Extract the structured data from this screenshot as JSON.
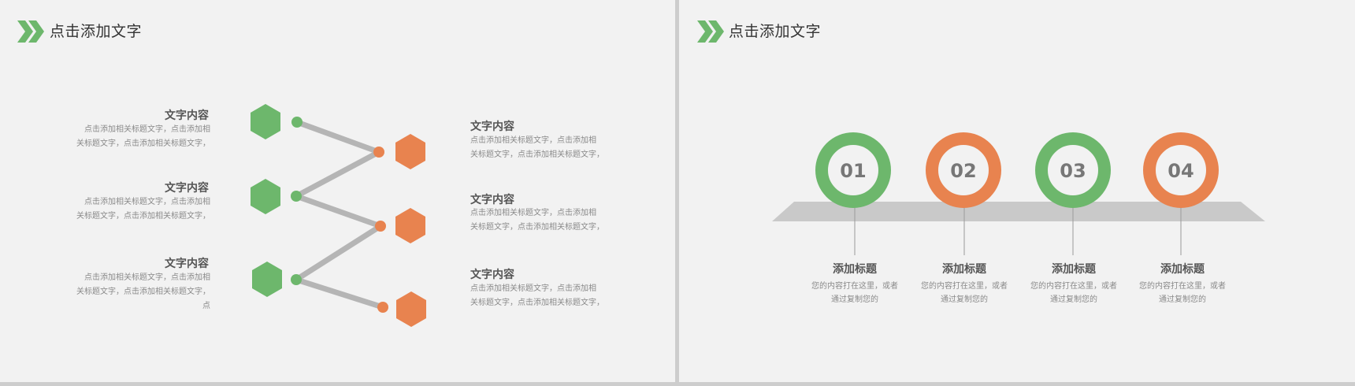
{
  "colors": {
    "green": "#6db76c",
    "orange": "#e8834f",
    "connector": "#b5b5b5",
    "platform": "#c9c9c9"
  },
  "left_slide": {
    "title": "点击添加文字",
    "title_icon": "double-chevron-right-icon",
    "left_items": [
      {
        "heading": "文字内容",
        "lines": [
          "点击添加相关标题文字，点击添加相",
          "关标题文字，点击添加相关标题文字，"
        ]
      },
      {
        "heading": "文字内容",
        "lines": [
          "点击添加相关标题文字，点击添加相",
          "关标题文字，点击添加相关标题文字，"
        ]
      },
      {
        "heading": "文字内容",
        "lines": [
          "点击添加相关标题文字，点击添加相",
          "关标题文字，点击添加相关标题文字，",
          "点"
        ]
      }
    ],
    "right_items": [
      {
        "heading": "文字内容",
        "lines": [
          "点击添加相关标题文字，点击添加相",
          "关标题文字，点击添加相关标题文字，"
        ]
      },
      {
        "heading": "文字内容",
        "lines": [
          "点击添加相关标题文字，点击添加相",
          "关标题文字，点击添加相关标题文字，"
        ]
      },
      {
        "heading": "文字内容",
        "lines": [
          "点击添加相关标题文字，点击添加相",
          "关标题文字，点击添加相关标题文字，"
        ]
      }
    ]
  },
  "right_slide": {
    "title": "点击添加文字",
    "title_icon": "double-chevron-right-icon",
    "steps": [
      {
        "number": "01",
        "color": "green",
        "title": "添加标题",
        "desc": [
          "您的内容打在这里，或者",
          "通过复制您的"
        ]
      },
      {
        "number": "02",
        "color": "orange",
        "title": "添加标题",
        "desc": [
          "您的内容打在这里，或者",
          "通过复制您的"
        ]
      },
      {
        "number": "03",
        "color": "green",
        "title": "添加标题",
        "desc": [
          "您的内容打在这里，或者",
          "通过复制您的"
        ]
      },
      {
        "number": "04",
        "color": "orange",
        "title": "添加标题",
        "desc": [
          "您的内容打在这里，或者",
          "通过复制您的"
        ]
      }
    ]
  }
}
